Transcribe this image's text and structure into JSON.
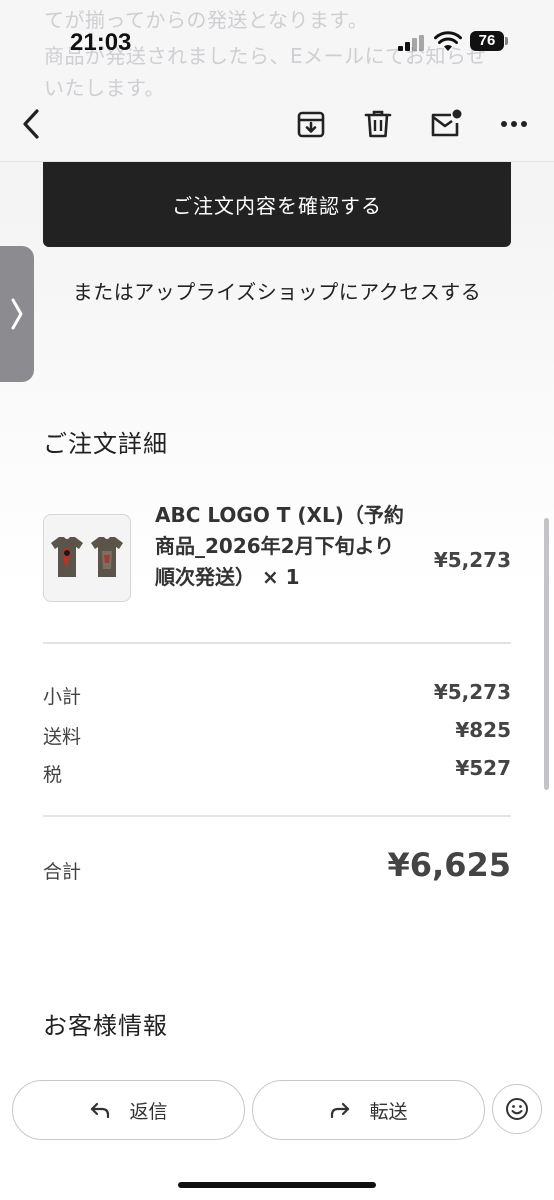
{
  "status_bar": {
    "time": "21:03",
    "battery": "76"
  },
  "email_peek": {
    "line1": "てが揃ってからの発送となります。",
    "line2": "商品が発送されましたら、Eメールにてお知らせ",
    "line3": "いたします。"
  },
  "toolbar": {
    "back_icon": "chevron-left-icon",
    "archive_icon": "archive-icon",
    "delete_icon": "trash-icon",
    "unread_icon": "mail-unread-icon",
    "more_icon": "more-icon"
  },
  "order": {
    "confirm_button": "ご注文内容を確認する",
    "shop_link": "またはアップライズショップにアクセスする",
    "details_title": "ご注文詳細",
    "item": {
      "name_line1": "ABC LOGO T (XL)（予約",
      "name_line2": "商品_2026年2月下旬より",
      "name_line3": "順次発送） × 1",
      "price": "¥5,273"
    },
    "subtotal_label": "小計",
    "subtotal_value": "¥5,273",
    "shipping_label": "送料",
    "shipping_value": "¥825",
    "tax_label": "税",
    "tax_value": "¥527",
    "total_label": "合計",
    "total_value": "¥6,625",
    "customer_info_title": "お客様情報"
  },
  "bottom_bar": {
    "reply_label": "返信",
    "forward_label": "転送"
  },
  "colors": {
    "button_dark": "#222222",
    "header_bg": "#f6f6f7",
    "text_gray": "#444444"
  }
}
